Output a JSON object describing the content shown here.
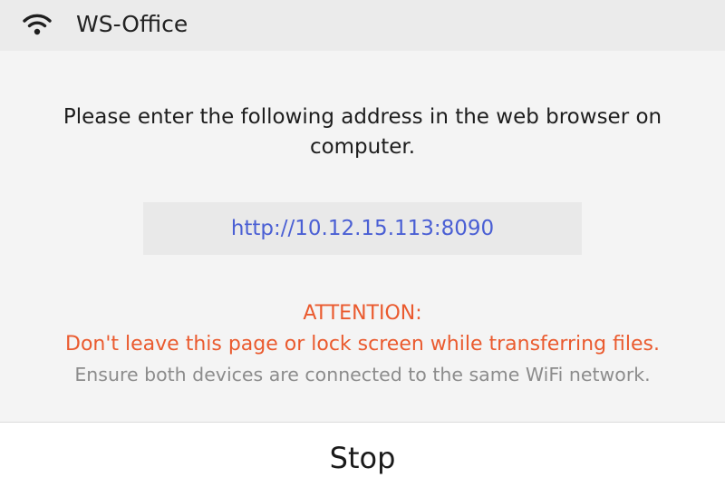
{
  "header": {
    "icon": "wifi-icon",
    "network_name": "WS-Office"
  },
  "instruction": {
    "text": "Please enter the following address in the web browser on computer."
  },
  "address": {
    "url": "http://10.12.15.113:8090"
  },
  "attention": {
    "title": "ATTENTION:",
    "warning": "Don't leave this page or lock screen while transferring files.",
    "note": "Ensure both devices are connected to the same WiFi network."
  },
  "footer": {
    "stop_label": "Stop"
  },
  "colors": {
    "header_bg": "#ebebeb",
    "page_bg": "#f4f4f4",
    "link": "#4a5fd4",
    "warning": "#ea5a2e",
    "note": "#8c8c8c"
  }
}
